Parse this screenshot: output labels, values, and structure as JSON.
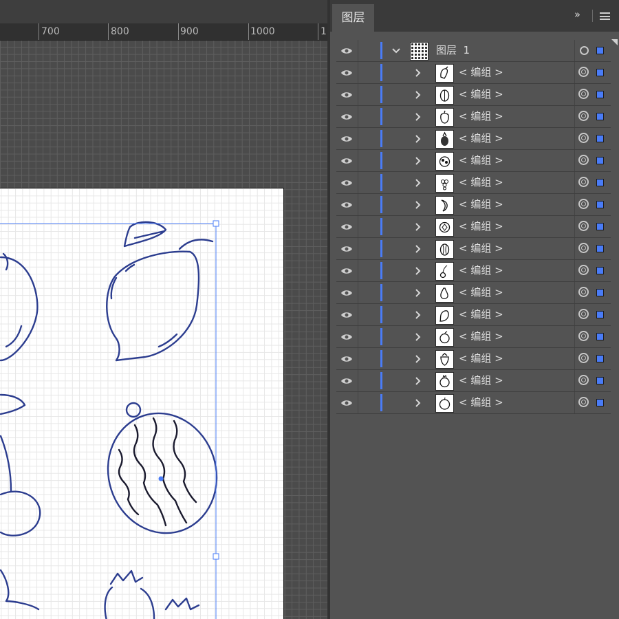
{
  "canvas": {
    "ruler_labels": [
      "700",
      "800",
      "900",
      "1000",
      "1"
    ]
  },
  "layers_panel": {
    "tab_label": "图层",
    "collapse_icon": "double-chevron-right-icon",
    "menu_icon": "hamburger-menu-icon",
    "top_layer": {
      "name": "图层  1",
      "expanded": true,
      "visible": true
    },
    "sublayer_label": "< 编组 >",
    "sublayers": [
      {
        "name": "< 编组 >",
        "thumb": "pepper"
      },
      {
        "name": "< 编组 >",
        "thumb": "melon"
      },
      {
        "name": "< 编组 >",
        "thumb": "apple"
      },
      {
        "name": "< 编组 >",
        "thumb": "pineapple"
      },
      {
        "name": "< 编组 >",
        "thumb": "grapes-round"
      },
      {
        "name": "< 编组 >",
        "thumb": "grapes"
      },
      {
        "name": "< 编组 >",
        "thumb": "banana"
      },
      {
        "name": "< 编组 >",
        "thumb": "kiwi"
      },
      {
        "name": "< 编组 >",
        "thumb": "watermelon"
      },
      {
        "name": "< 编组 >",
        "thumb": "cherry"
      },
      {
        "name": "< 编组 >",
        "thumb": "pear"
      },
      {
        "name": "< 编组 >",
        "thumb": "lemon"
      },
      {
        "name": "< 编组 >",
        "thumb": "peach"
      },
      {
        "name": "< 编组 >",
        "thumb": "strawberry"
      },
      {
        "name": "< 编组 >",
        "thumb": "pomegranate"
      },
      {
        "name": "< 编组 >",
        "thumb": "orange"
      }
    ],
    "colors": {
      "layer_accent": "#4a7cf7",
      "panel_bg": "#535353",
      "header_bg": "#3a3a3a"
    }
  }
}
